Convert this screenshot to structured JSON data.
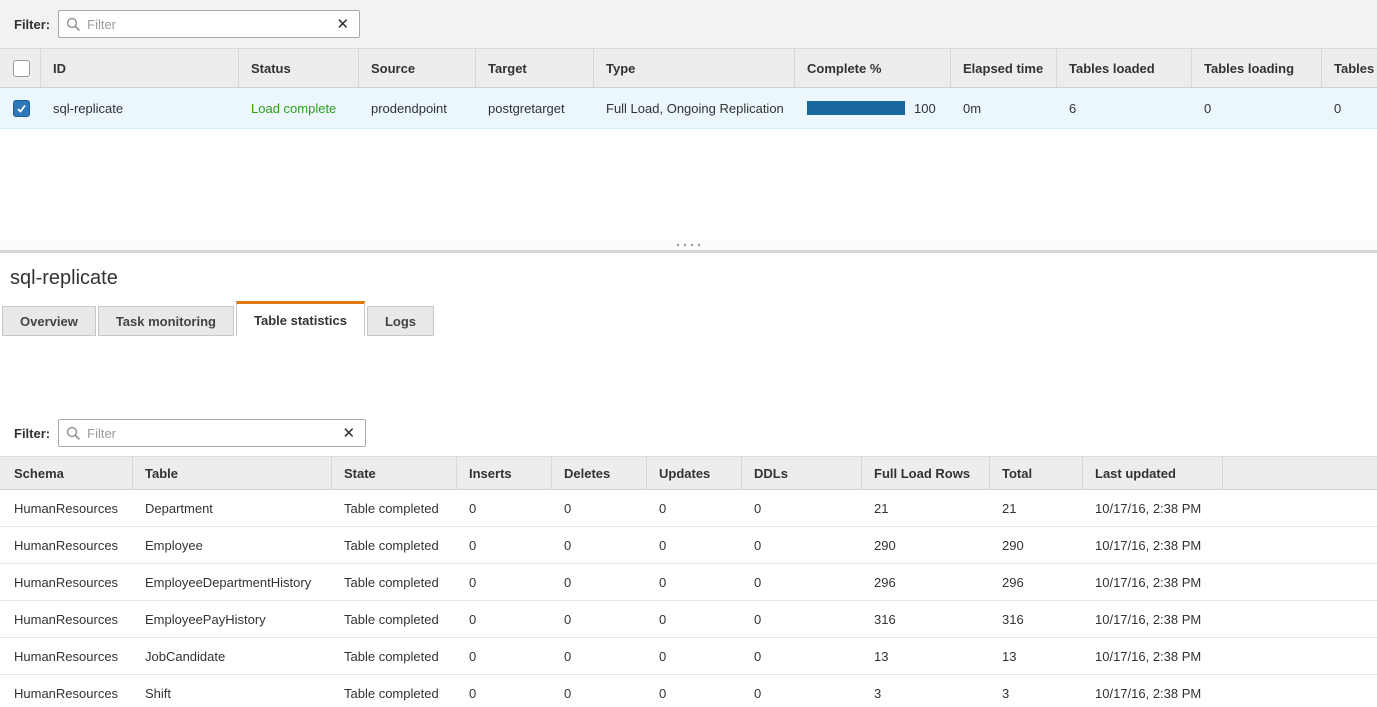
{
  "colors": {
    "accent_orange": "#e0780f",
    "progress_blue": "#19659e",
    "status_green": "#2ea017",
    "selected_row_bg": "#ebf6fd"
  },
  "tasks_panel": {
    "filter": {
      "label": "Filter:",
      "placeholder": "Filter",
      "clear_icon": "✕"
    },
    "table": {
      "columns": [
        "ID",
        "Status",
        "Source",
        "Target",
        "Type",
        "Complete %",
        "Elapsed time",
        "Tables loaded",
        "Tables loading",
        "Tables"
      ],
      "row": {
        "id": "sql-replicate",
        "status": "Load complete",
        "source": "prodendpoint",
        "target": "postgretarget",
        "type": "Full Load, Ongoing Replication",
        "complete_pct": 100,
        "complete_label": "100",
        "elapsed_time": "0m",
        "tables_loaded": "6",
        "tables_loading": "0",
        "tables_last": "0"
      }
    }
  },
  "detail_panel": {
    "title": "sql-replicate",
    "tabs": [
      "Overview",
      "Task monitoring",
      "Table statistics",
      "Logs"
    ],
    "active_tab": "Table statistics",
    "filter": {
      "label": "Filter:",
      "placeholder": "Filter",
      "clear_icon": "✕"
    },
    "stats_table": {
      "columns": [
        "Schema",
        "Table",
        "State",
        "Inserts",
        "Deletes",
        "Updates",
        "DDLs",
        "Full Load Rows",
        "Total",
        "Last updated"
      ],
      "rows": [
        {
          "schema": "HumanResources",
          "table": "Department",
          "state": "Table completed",
          "inserts": "0",
          "deletes": "0",
          "updates": "0",
          "ddls": "0",
          "full_load_rows": "21",
          "total": "21",
          "last_updated": "10/17/16, 2:38 PM"
        },
        {
          "schema": "HumanResources",
          "table": "Employee",
          "state": "Table completed",
          "inserts": "0",
          "deletes": "0",
          "updates": "0",
          "ddls": "0",
          "full_load_rows": "290",
          "total": "290",
          "last_updated": "10/17/16, 2:38 PM"
        },
        {
          "schema": "HumanResources",
          "table": "EmployeeDepartmentHistory",
          "state": "Table completed",
          "inserts": "0",
          "deletes": "0",
          "updates": "0",
          "ddls": "0",
          "full_load_rows": "296",
          "total": "296",
          "last_updated": "10/17/16, 2:38 PM"
        },
        {
          "schema": "HumanResources",
          "table": "EmployeePayHistory",
          "state": "Table completed",
          "inserts": "0",
          "deletes": "0",
          "updates": "0",
          "ddls": "0",
          "full_load_rows": "316",
          "total": "316",
          "last_updated": "10/17/16, 2:38 PM"
        },
        {
          "schema": "HumanResources",
          "table": "JobCandidate",
          "state": "Table completed",
          "inserts": "0",
          "deletes": "0",
          "updates": "0",
          "ddls": "0",
          "full_load_rows": "13",
          "total": "13",
          "last_updated": "10/17/16, 2:38 PM"
        },
        {
          "schema": "HumanResources",
          "table": "Shift",
          "state": "Table completed",
          "inserts": "0",
          "deletes": "0",
          "updates": "0",
          "ddls": "0",
          "full_load_rows": "3",
          "total": "3",
          "last_updated": "10/17/16, 2:38 PM"
        }
      ]
    }
  }
}
